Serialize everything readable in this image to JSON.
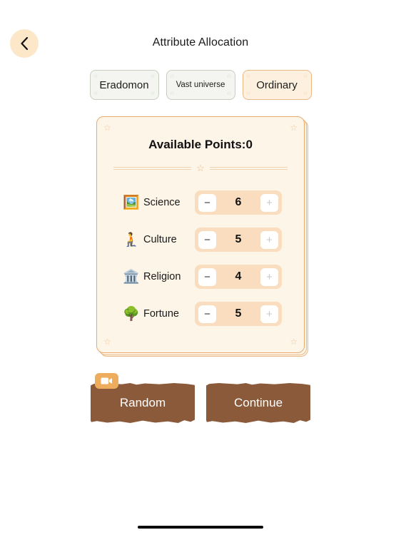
{
  "header": {
    "back_icon": "chevron-left-icon",
    "title": "Attribute Allocation"
  },
  "chips": [
    {
      "label": "Eradomon",
      "selected": false,
      "size": "normal"
    },
    {
      "label": "Vast universe",
      "selected": false,
      "size": "small"
    },
    {
      "label": "Ordinary",
      "selected": true,
      "size": "normal"
    }
  ],
  "card": {
    "points_label": "Available Points:0",
    "divider_star": "☆",
    "corner_star": "☆",
    "attributes": [
      {
        "icon": "🖼️",
        "icon_name": "science-icon",
        "name": "Science",
        "value": "6",
        "minus": "−",
        "plus": "+",
        "minus_enabled": true,
        "plus_enabled": false
      },
      {
        "icon": "🧎",
        "icon_name": "culture-icon",
        "name": "Culture",
        "value": "5",
        "minus": "−",
        "plus": "+",
        "minus_enabled": true,
        "plus_enabled": false
      },
      {
        "icon": "🏛️",
        "icon_name": "religion-icon",
        "name": "Religion",
        "value": "4",
        "minus": "−",
        "plus": "+",
        "minus_enabled": true,
        "plus_enabled": false
      },
      {
        "icon": "🌳",
        "icon_name": "fortune-icon",
        "name": "Fortune",
        "value": "5",
        "minus": "−",
        "plus": "+",
        "minus_enabled": true,
        "plus_enabled": false
      }
    ]
  },
  "actions": {
    "random_label": "Random",
    "continue_label": "Continue",
    "video_badge_icon": "video-camera-icon"
  },
  "colors": {
    "accent_orange": "#e9a96d",
    "card_bg": "#fdf5e8",
    "stepper_bg": "#f9ddbe",
    "button_brown": "#8a5a3b",
    "badge_orange": "#edad5c",
    "back_button_bg": "#fce8c8"
  }
}
